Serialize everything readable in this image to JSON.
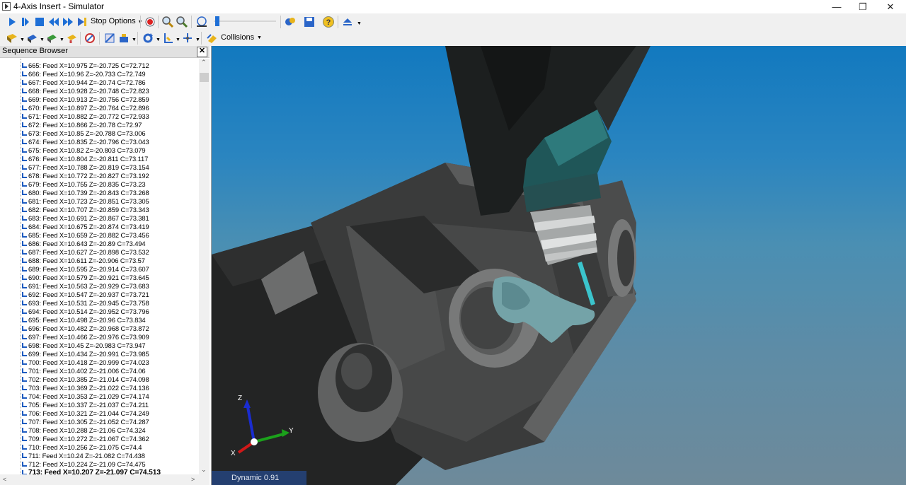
{
  "window": {
    "title": "4-Axis Insert - Simulator",
    "minimize": "—",
    "restore": "❐",
    "close": "✕"
  },
  "toolbar1": {
    "stop_options_label": "Stop Options",
    "icons": [
      "play-icon",
      "step-icon",
      "stop-icon",
      "rewind-icon",
      "fast-forward-icon",
      "jump-end-icon",
      "record-icon",
      "zoom-in-icon",
      "zoom-out-icon",
      "fit-view-icon",
      "speed-slider",
      "settings-icon",
      "save-icon",
      "help-icon",
      "eject-icon"
    ]
  },
  "toolbar2": {
    "collisions_label": "Collisions",
    "icons": [
      "view-workpiece-icon",
      "view-tool-icon",
      "view-machine-icon",
      "view-holder-icon",
      "gauge-icon",
      "toolpath-icon",
      "fixture-icon",
      "rotate-icon",
      "axis-icon",
      "axis-mirror-icon",
      "collisions-icon"
    ]
  },
  "sidebar": {
    "title": "Sequence Browser",
    "close_label": "✕",
    "rows": [
      "665: Feed X=10.975 Z=-20.725 C=72.712",
      "666: Feed X=10.96 Z=-20.733 C=72.749",
      "667: Feed X=10.944 Z=-20.74 C=72.786",
      "668: Feed X=10.928 Z=-20.748 C=72.823",
      "669: Feed X=10.913 Z=-20.756 C=72.859",
      "670: Feed X=10.897 Z=-20.764 C=72.896",
      "671: Feed X=10.882 Z=-20.772 C=72.933",
      "672: Feed X=10.866 Z=-20.78 C=72.97",
      "673: Feed X=10.85 Z=-20.788 C=73.006",
      "674: Feed X=10.835 Z=-20.796 C=73.043",
      "675: Feed X=10.82 Z=-20.803 C=73.079",
      "676: Feed X=10.804 Z=-20.811 C=73.117",
      "677: Feed X=10.788 Z=-20.819 C=73.154",
      "678: Feed X=10.772 Z=-20.827 C=73.192",
      "679: Feed X=10.755 Z=-20.835 C=73.23",
      "680: Feed X=10.739 Z=-20.843 C=73.268",
      "681: Feed X=10.723 Z=-20.851 C=73.305",
      "682: Feed X=10.707 Z=-20.859 C=73.343",
      "683: Feed X=10.691 Z=-20.867 C=73.381",
      "684: Feed X=10.675 Z=-20.874 C=73.419",
      "685: Feed X=10.659 Z=-20.882 C=73.456",
      "686: Feed X=10.643 Z=-20.89 C=73.494",
      "687: Feed X=10.627 Z=-20.898 C=73.532",
      "688: Feed X=10.611 Z=-20.906 C=73.57",
      "689: Feed X=10.595 Z=-20.914 C=73.607",
      "690: Feed X=10.579 Z=-20.921 C=73.645",
      "691: Feed X=10.563 Z=-20.929 C=73.683",
      "692: Feed X=10.547 Z=-20.937 C=73.721",
      "693: Feed X=10.531 Z=-20.945 C=73.758",
      "694: Feed X=10.514 Z=-20.952 C=73.796",
      "695: Feed X=10.498 Z=-20.96 C=73.834",
      "696: Feed X=10.482 Z=-20.968 C=73.872",
      "697: Feed X=10.466 Z=-20.976 C=73.909",
      "698: Feed X=10.45 Z=-20.983 C=73.947",
      "699: Feed X=10.434 Z=-20.991 C=73.985",
      "700: Feed X=10.418 Z=-20.999 C=74.023",
      "701: Feed X=10.402 Z=-21.006 C=74.06",
      "702: Feed X=10.385 Z=-21.014 C=74.098",
      "703: Feed X=10.369 Z=-21.022 C=74.136",
      "704: Feed X=10.353 Z=-21.029 C=74.174",
      "705: Feed X=10.337 Z=-21.037 C=74.211",
      "706: Feed X=10.321 Z=-21.044 C=74.249",
      "707: Feed X=10.305 Z=-21.052 C=74.287",
      "708: Feed X=10.288 Z=-21.06 C=74.324",
      "709: Feed X=10.272 Z=-21.067 C=74.362",
      "710: Feed X=10.256 Z=-21.075 C=74.4",
      "711: Feed X=10.24 Z=-21.082 C=74.438",
      "712: Feed X=10.224 Z=-21.09 C=74.475",
      "713: Feed X=10.207 Z=-21.097 C=74.513"
    ],
    "selected_index": 48
  },
  "viewport": {
    "status": "Dynamic 0.91",
    "axis_labels": {
      "z": "Z",
      "y": "Y",
      "x": "X"
    },
    "background_top": "#1279bf",
    "background_bottom": "#6e8a9a"
  }
}
